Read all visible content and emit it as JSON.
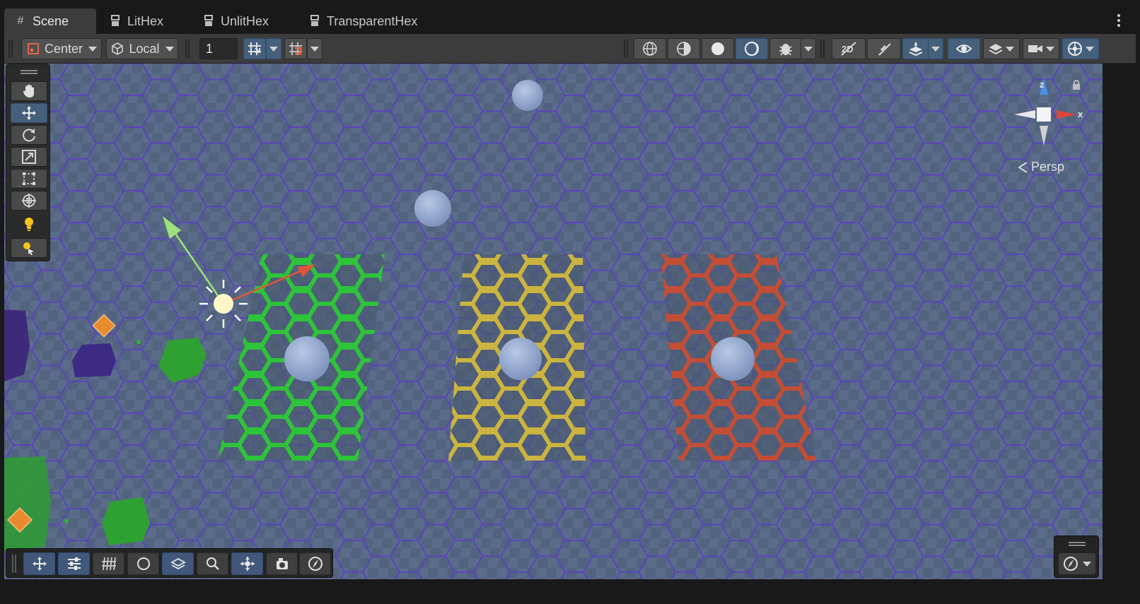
{
  "tabs": [
    {
      "label": "Scene",
      "icon": "hash-icon",
      "active": true
    },
    {
      "label": "LitHex",
      "icon": "prefab-icon",
      "active": false
    },
    {
      "label": "UnlitHex",
      "icon": "prefab-icon",
      "active": false
    },
    {
      "label": "TransparentHex",
      "icon": "prefab-icon",
      "active": false
    }
  ],
  "toolbar": {
    "pivot_label": "Center",
    "space_label": "Local",
    "snap_value": "1",
    "accent_color": "#46607c"
  },
  "scene": {
    "projection_label": "Persp",
    "axis_x": "x",
    "axis_z": "z",
    "hex_colors": {
      "green": "#2fbf3a",
      "yellow": "#c9b23a",
      "red": "#c44a32",
      "grid": "#5a3cb8"
    }
  },
  "tool_panel": [
    "hand-tool",
    "move-tool",
    "rotate-tool",
    "scale-tool",
    "rect-tool",
    "transform-tool",
    "light-icon",
    "custom-tool"
  ],
  "bottom_overlay": [
    "move-icon",
    "sliders-icon",
    "grid-icon",
    "shading-icon",
    "layers-icon",
    "search-icon",
    "pivot-icon",
    "camera-icon",
    "compass-icon"
  ]
}
